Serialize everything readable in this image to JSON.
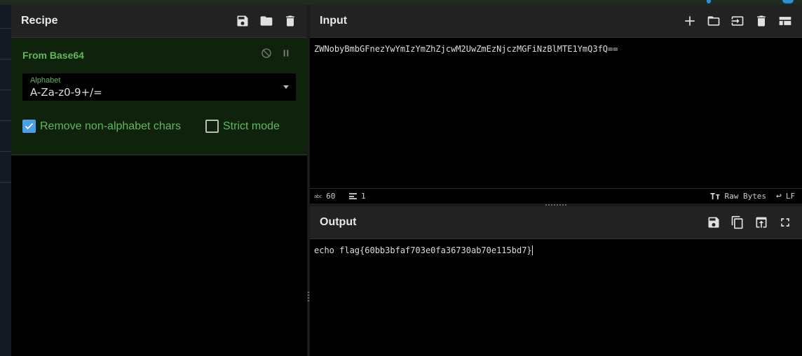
{
  "recipe": {
    "title": "Recipe",
    "icons": [
      "save-icon",
      "folder-icon",
      "trash-icon"
    ],
    "operation": {
      "title": "From Base64",
      "icons": [
        "disable-icon",
        "pause-icon"
      ],
      "alphabet_label": "Alphabet",
      "alphabet_value": "A-Za-z0-9+/=",
      "remove_label": "Remove non-alphabet chars",
      "remove_checked": true,
      "strict_label": "Strict mode",
      "strict_checked": false
    }
  },
  "input": {
    "title": "Input",
    "icons": [
      "plus-icon",
      "folder-icon",
      "import-icon",
      "trash-icon",
      "layout-icon"
    ],
    "text": "ZWNobyBmbGFnezYwYmIzYmZhZjcwM2UwZmEzNjczMGFiNzBlMTE1YmQ3fQ==",
    "status": {
      "length_label": "abc",
      "length": "60",
      "lines": "1",
      "encoding": "Raw Bytes",
      "eol": "LF"
    }
  },
  "output": {
    "title": "Output",
    "icons": [
      "save-icon",
      "copy-icon",
      "replace-input-icon",
      "maximize-icon"
    ],
    "text": "echo flag{60bb3bfaf703e0fa36730ab70e115bd7}"
  },
  "colors": {
    "accent_green": "#5fb85c",
    "op_background": "#0f230c",
    "checkbox_blue": "#4aa0e6",
    "header_gray": "#222222"
  }
}
